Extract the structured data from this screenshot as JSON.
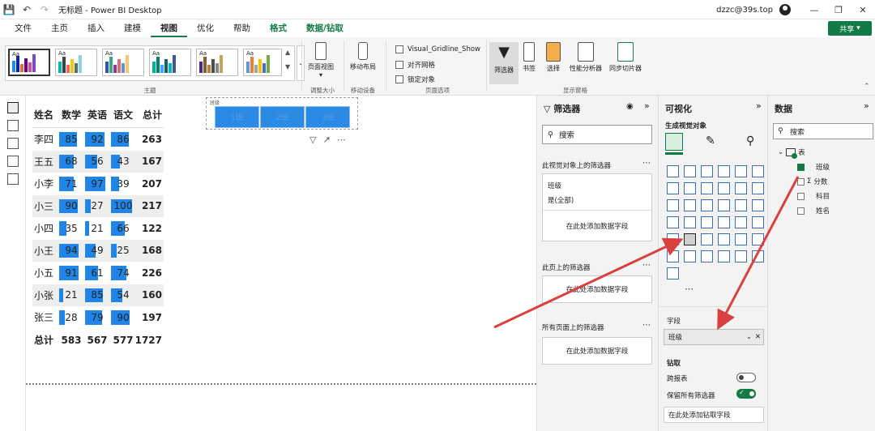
{
  "titlebar": {
    "doc_name": "无标题 - Power BI Desktop",
    "user": "dzzc@39s.top"
  },
  "menu": {
    "items": [
      "文件",
      "主页",
      "插入",
      "建模",
      "视图",
      "优化",
      "帮助",
      "格式",
      "数据/钻取"
    ],
    "active": "视图",
    "share": "共享"
  },
  "ribbon": {
    "groups": [
      "主题",
      "调整大小",
      "移动设备",
      "页面选项",
      "显示窗格"
    ],
    "page_view": "页面视图",
    "mobile_layout": "移动布局",
    "options": [
      "Visual_Gridline_Show",
      "对齐网格",
      "锁定对象"
    ],
    "panes": [
      "筛选器",
      "书签",
      "选择",
      "性能分析器",
      "同步切片器"
    ]
  },
  "matrix": {
    "headers": [
      "姓名",
      "数学",
      "英语",
      "语文",
      "总计"
    ],
    "rows": [
      {
        "name": "李四",
        "math": 85,
        "eng": 92,
        "chn": 86,
        "total": 263
      },
      {
        "name": "王五",
        "math": 68,
        "eng": 56,
        "chn": 43,
        "total": 167
      },
      {
        "name": "小李",
        "math": 71,
        "eng": 97,
        "chn": 39,
        "total": 207
      },
      {
        "name": "小三",
        "math": 90,
        "eng": 27,
        "chn": 100,
        "total": 217
      },
      {
        "name": "小四",
        "math": 35,
        "eng": 21,
        "chn": 66,
        "total": 122
      },
      {
        "name": "小王",
        "math": 94,
        "eng": 49,
        "chn": 25,
        "total": 168
      },
      {
        "name": "小五",
        "math": 91,
        "eng": 61,
        "chn": 74,
        "total": 226
      },
      {
        "name": "小张",
        "math": 21,
        "eng": 85,
        "chn": 54,
        "total": 160
      },
      {
        "name": "张三",
        "math": 28,
        "eng": 79,
        "chn": 90,
        "total": 197
      }
    ],
    "footer": {
      "label": "总计",
      "math": 583,
      "eng": 567,
      "chn": 577,
      "total": 1727
    },
    "bar_color": "#1f86e8"
  },
  "slicer": {
    "title": "班级",
    "options": [
      "1班",
      "2班",
      "3班"
    ]
  },
  "filters": {
    "title": "筛选器",
    "search": "搜索",
    "visual_section": "此视觉对象上的筛选器",
    "field": "班级",
    "field_value": "是(全部)",
    "add_field": "在此处添加数据字段",
    "page_section": "此页上的筛选器",
    "all_section": "所有页面上的筛选器"
  },
  "viz": {
    "title": "可视化",
    "build": "生成视觉对象",
    "fields_label": "字段",
    "field_value": "班级",
    "drill_label": "钻取",
    "cross_report": "跨报表",
    "keep_filters": "保留所有筛选器",
    "drill_add": "在此处添加钻取字段"
  },
  "data": {
    "title": "数据",
    "search": "搜索",
    "table": "表",
    "fields": [
      {
        "name": "班级",
        "checked": true
      },
      {
        "name": "分数",
        "checked": false,
        "sigma": true
      },
      {
        "name": "科目",
        "checked": false
      },
      {
        "name": "姓名",
        "checked": false
      }
    ]
  },
  "accent": "#117a45",
  "arrow_color": "#d94040"
}
